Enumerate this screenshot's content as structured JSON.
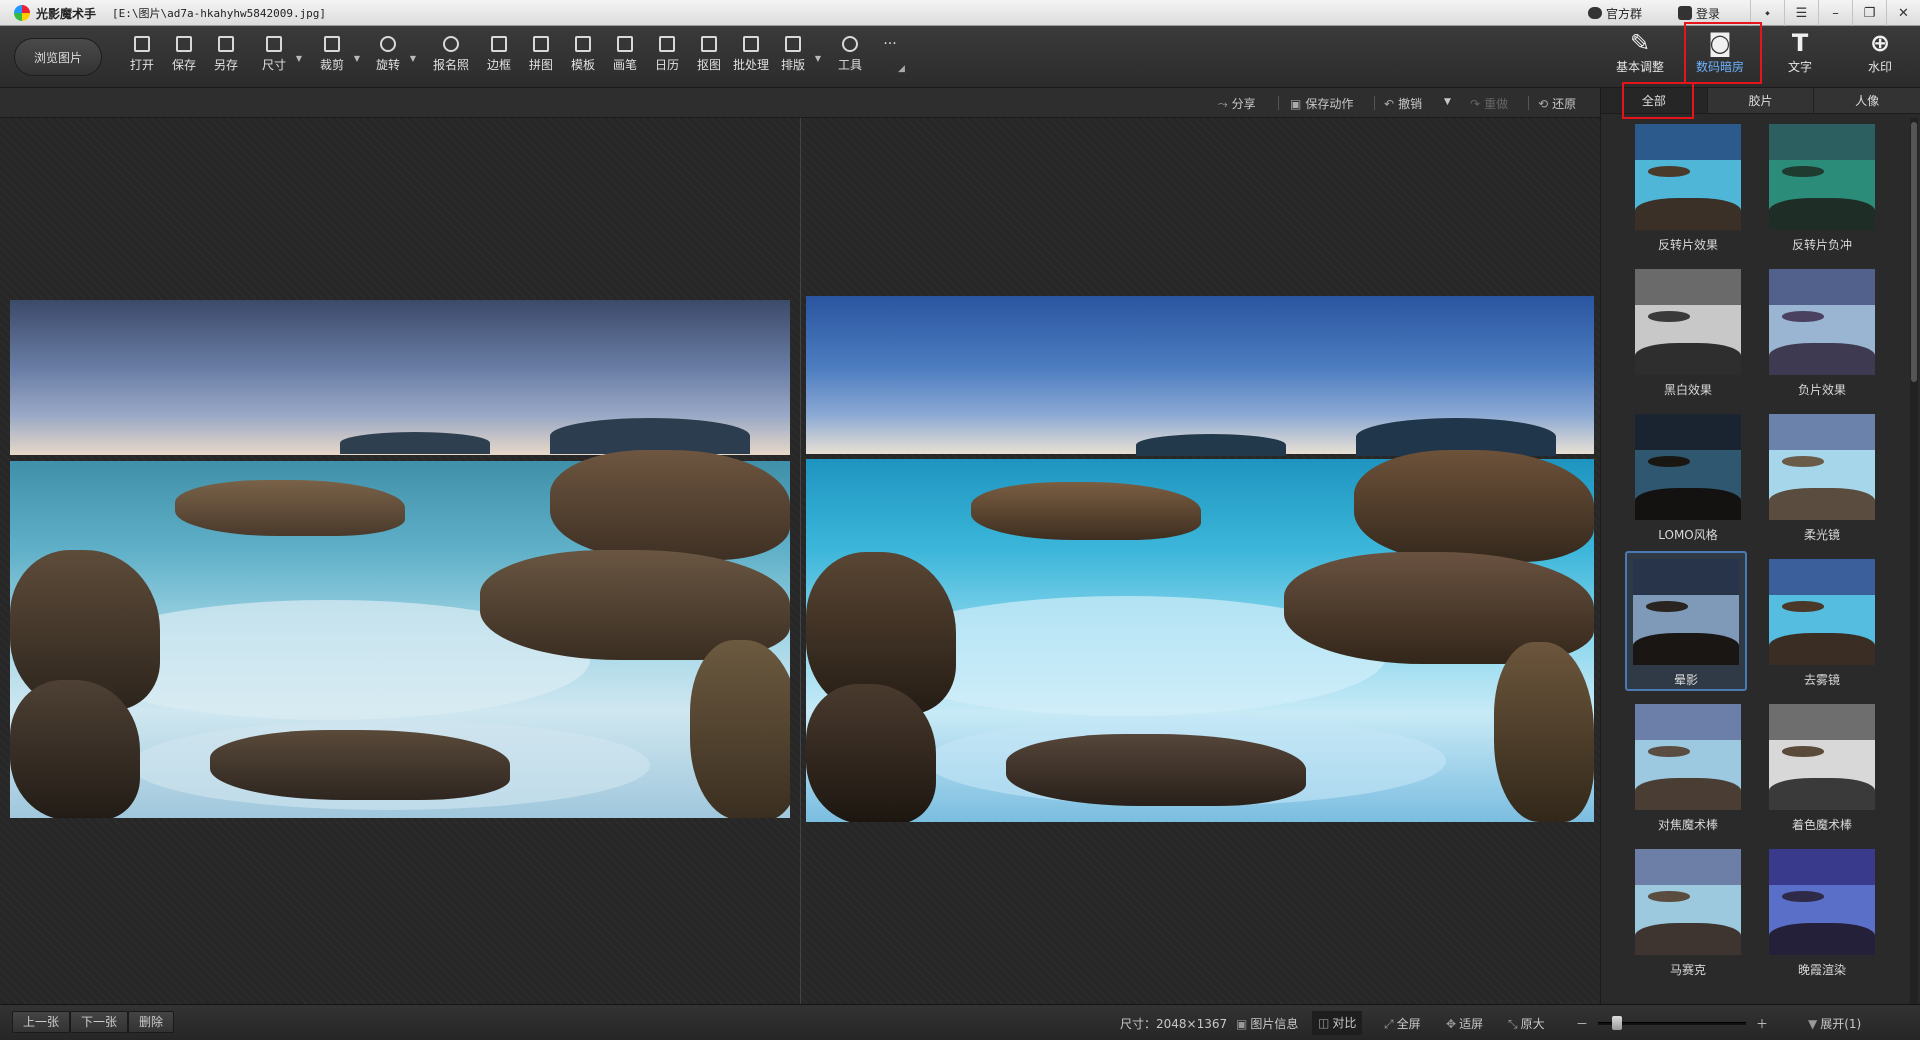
{
  "window": {
    "app_name": "光影魔术手",
    "file_path": "[E:\\图片\\ad7a-hkahyhw5842009.jpg]",
    "group_label": "官方群",
    "login_label": "登录"
  },
  "toolbar": {
    "browse_label": "浏览图片",
    "tools": [
      "打开",
      "保存",
      "另存",
      "尺寸",
      "裁剪",
      "旋转",
      "报名照",
      "边框",
      "拼图",
      "模板",
      "画笔",
      "日历",
      "抠图",
      "批处理",
      "排版",
      "工具"
    ],
    "more": "···"
  },
  "right_tools": [
    {
      "label": "基本调整",
      "icon": "✎"
    },
    {
      "label": "数码暗房",
      "icon": "◙"
    },
    {
      "label": "文字",
      "icon": "T"
    },
    {
      "label": "水印",
      "icon": "⊕"
    }
  ],
  "actions": {
    "share": "分享",
    "save_action": "保存动作",
    "undo": "撤销",
    "redo": "重做",
    "restore": "还原"
  },
  "effect_tabs": [
    "全部",
    "胶片",
    "人像"
  ],
  "effects": [
    {
      "label": "反转片效果",
      "sky": "#2c5a8c",
      "sea": "#4fb6d8"
    },
    {
      "label": "反转片负冲",
      "sky": "#2b5f60",
      "sea": "#2b8c7a"
    },
    {
      "label": "黑白效果",
      "sky": "#6a6a6a",
      "sea": "#c8c8c8"
    },
    {
      "label": "负片效果",
      "sky": "#52608c",
      "sea": "#9ab5d2"
    },
    {
      "label": "LOMO风格",
      "sky": "#1a2430",
      "sea": "#2f5870"
    },
    {
      "label": "柔光镜",
      "sky": "#6b82aa",
      "sea": "#a6d6ea"
    },
    {
      "label": "晕影",
      "sky": "#28344a",
      "sea": "#7f9ab8"
    },
    {
      "label": "去雾镜",
      "sky": "#3b5f9a",
      "sea": "#55bde0"
    },
    {
      "label": "对焦魔术棒",
      "sky": "#6b7fa8",
      "sea": "#9cc9df"
    },
    {
      "label": "着色魔术棒",
      "sky": "#6e6e6e",
      "sea": "#d8d8d8"
    },
    {
      "label": "马赛克",
      "sky": "#6d7fa6",
      "sea": "#9cc9de"
    },
    {
      "label": "晚霞渲染",
      "sky": "#3a3a8c",
      "sea": "#5a6fc8"
    }
  ],
  "selected_effect": "晕影",
  "statusbar": {
    "prev": "上一张",
    "next": "下一张",
    "delete": "删除",
    "size_text": "尺寸：2048×1367",
    "info": "图片信息",
    "compare": "对比",
    "fullscreen": "全屏",
    "fit": "适屏",
    "original": "原大",
    "minus": "－",
    "plus": "＋",
    "expand": "展开(1)",
    "zoom_fraction": 0.1
  },
  "colors": {
    "accent": "#6db3ff",
    "highlight": "#e8141c",
    "selection": "#4a7ab3"
  }
}
